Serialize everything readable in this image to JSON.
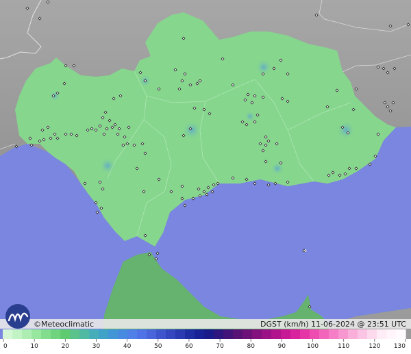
{
  "footer": {
    "brand": "Meteoclimatic",
    "copyright_symbol": "©",
    "info": "DGST (km/h)  11-06-2024 @ 23:51 UTC"
  },
  "legend": {
    "ticks": [
      "0",
      "10",
      "20",
      "30",
      "40",
      "50",
      "60",
      "70",
      "80",
      "90",
      "100",
      "110",
      "120",
      "130"
    ],
    "colors": [
      "#d5f7d5",
      "#c2f3c4",
      "#aeeeb2",
      "#98e79e",
      "#82de8c",
      "#6fd47d",
      "#5fcb71",
      "#5ac28a",
      "#4fb9a2",
      "#46aeb8",
      "#41a2c8",
      "#4296d6",
      "#478be0",
      "#4e80e8",
      "#4f72e6",
      "#4a64dc",
      "#3f55ce",
      "#3547bf",
      "#2a3ab0",
      "#1f2da2",
      "#182296",
      "#1a1a8a",
      "#2d167f",
      "#421479",
      "#581276",
      "#6c1178",
      "#83117e",
      "#9a1286",
      "#b2148e",
      "#c71996",
      "#d9239e",
      "#e635a6",
      "#ee4cb0",
      "#f365bb",
      "#f67ec6",
      "#f896d0",
      "#faaeda",
      "#fbc4e4",
      "#fdd9ed",
      "#feecf6",
      "#fff5fb",
      "#fffafd"
    ]
  },
  "map": {
    "sea_color": "#7a86df",
    "land_color": "#9b9b9b",
    "region_color": "#86d68e",
    "africa_color": "#66b26f"
  },
  "stations_count_visible": 200
}
